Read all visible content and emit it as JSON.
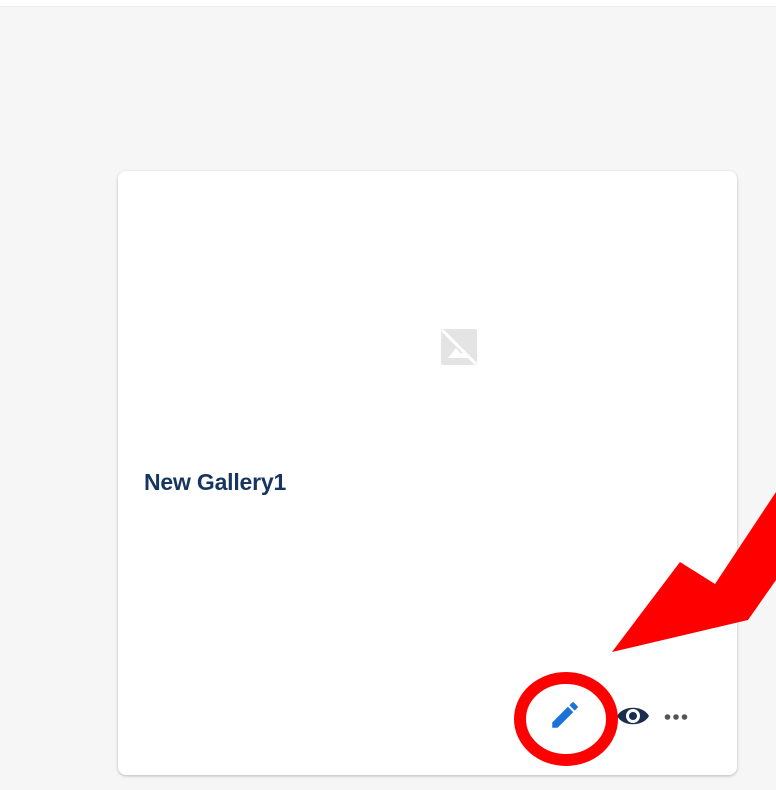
{
  "gallery": {
    "title": "New Gallery1"
  },
  "icons": {
    "placeholder": "broken-image-icon",
    "edit": "pencil-icon",
    "preview": "eye-icon",
    "more": "more-horizontal-icon"
  },
  "colors": {
    "background": "#f6f6f6",
    "card": "#ffffff",
    "title": "#16365f",
    "edit_icon": "#1a73d9",
    "preview_icon": "#1b2d4f",
    "more_icon": "#555555",
    "annotation": "#ff0000"
  },
  "annotation": {
    "circle_target": "edit-button",
    "arrow_points_to": "edit-button"
  }
}
